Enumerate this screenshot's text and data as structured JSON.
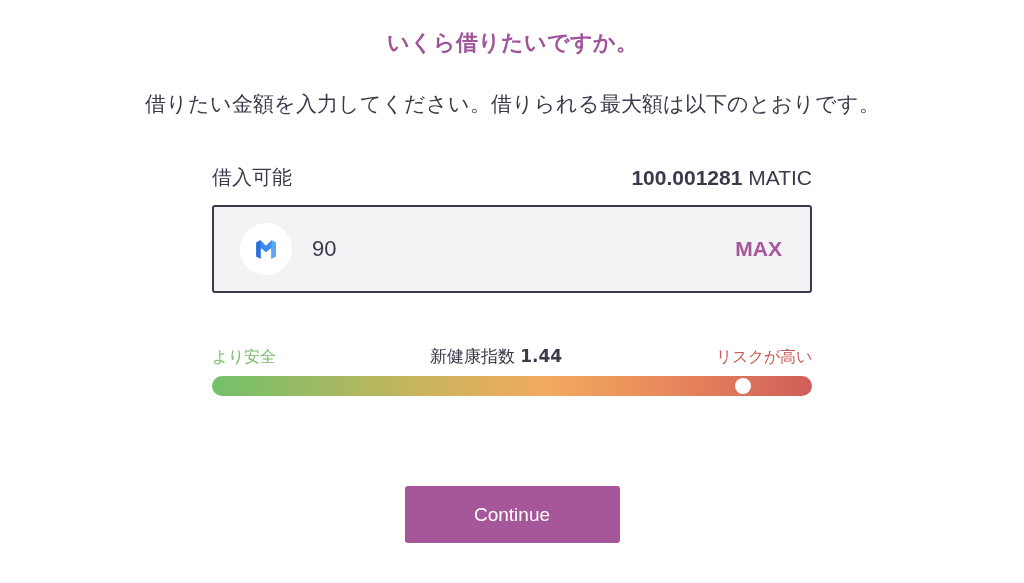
{
  "title": "いくら借りたいですか。",
  "subtitle": "借りたい金額を入力してください。借りられる最大額は以下のとおりです。",
  "available": {
    "label": "借入可能",
    "amount": "100.001281",
    "unit": "MATIC"
  },
  "amount_field": {
    "value": "90",
    "max_label": "MAX"
  },
  "health": {
    "safe_label": "より安全",
    "title": "新健康指数",
    "value": "1.44",
    "risk_label": "リスクが高い",
    "level": 0.885
  },
  "continue_button": "Continue"
}
